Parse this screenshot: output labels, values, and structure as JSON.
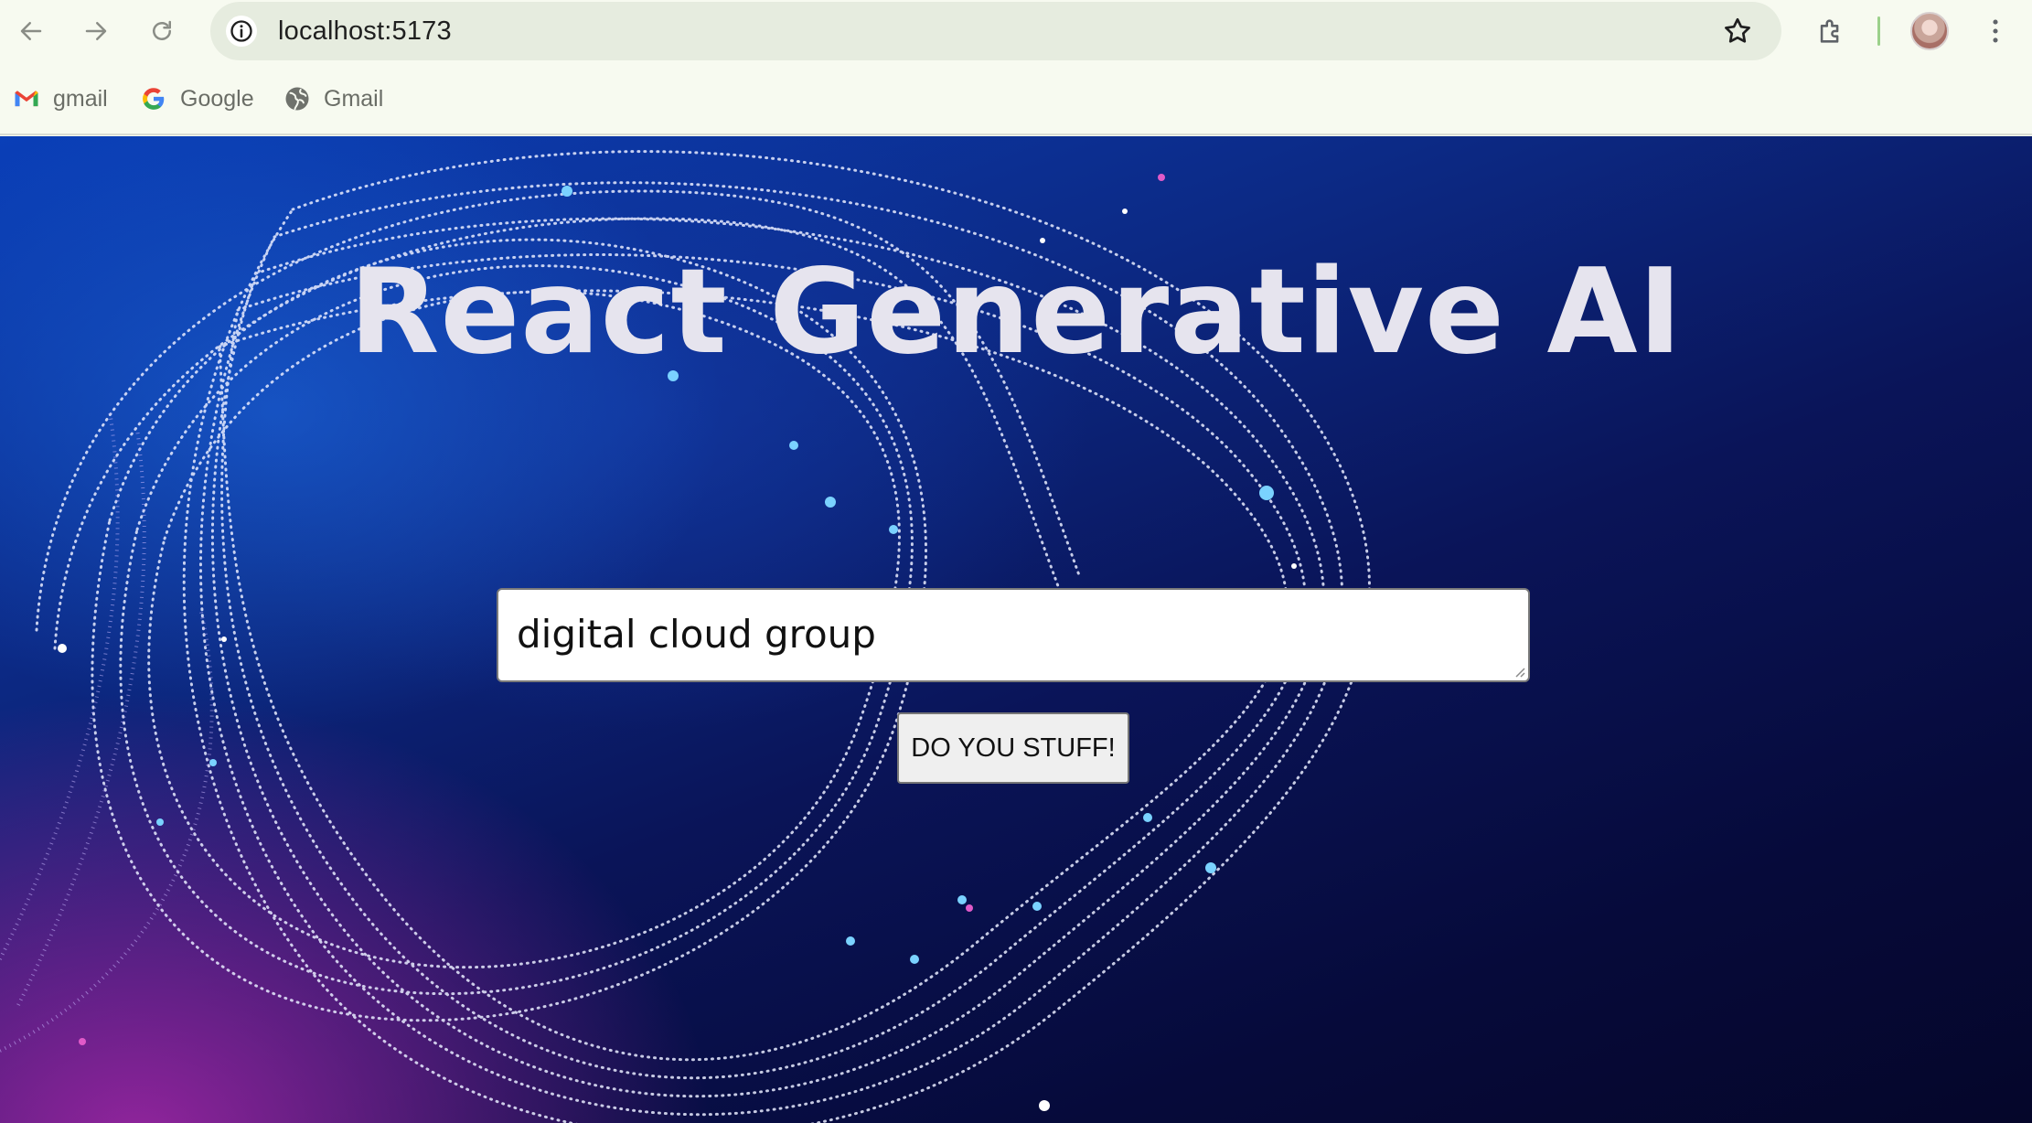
{
  "browser": {
    "url": "localhost:5173",
    "bookmarks": [
      {
        "label": "gmail",
        "icon": "gmail-icon"
      },
      {
        "label": "Google",
        "icon": "google-icon"
      },
      {
        "label": "Gmail",
        "icon": "globe-icon"
      }
    ]
  },
  "page": {
    "title": "React Generative AI",
    "prompt_value": "digital cloud group",
    "submit_label": "DO YOU STUFF!"
  },
  "colors": {
    "title_text": "#e6e4ee",
    "background_deep": "#05062a",
    "background_blue": "#0a3fb8",
    "accent_magenta": "#aa28aa"
  }
}
